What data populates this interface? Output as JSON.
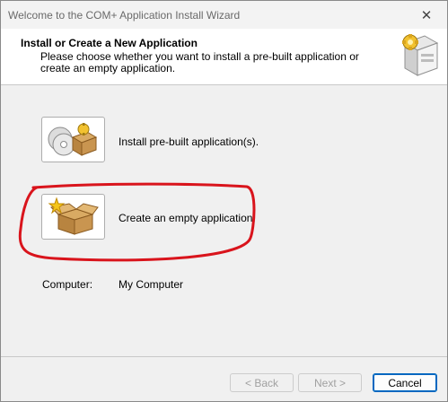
{
  "window": {
    "title": "Welcome to the COM+ Application Install Wizard",
    "close_glyph": "✕"
  },
  "header": {
    "title": "Install or Create a New Application",
    "description": "Please choose whether you want to install a pre-built application or create an empty application."
  },
  "options": [
    {
      "label": "Install pre-built application(s)."
    },
    {
      "label": "Create an empty application."
    }
  ],
  "computer": {
    "label": "Computer:",
    "value": "My Computer"
  },
  "buttons": {
    "back": "< Back",
    "next": "Next >",
    "cancel": "Cancel"
  },
  "colors": {
    "annotation": "#d9141c",
    "accent": "#0067c0"
  }
}
